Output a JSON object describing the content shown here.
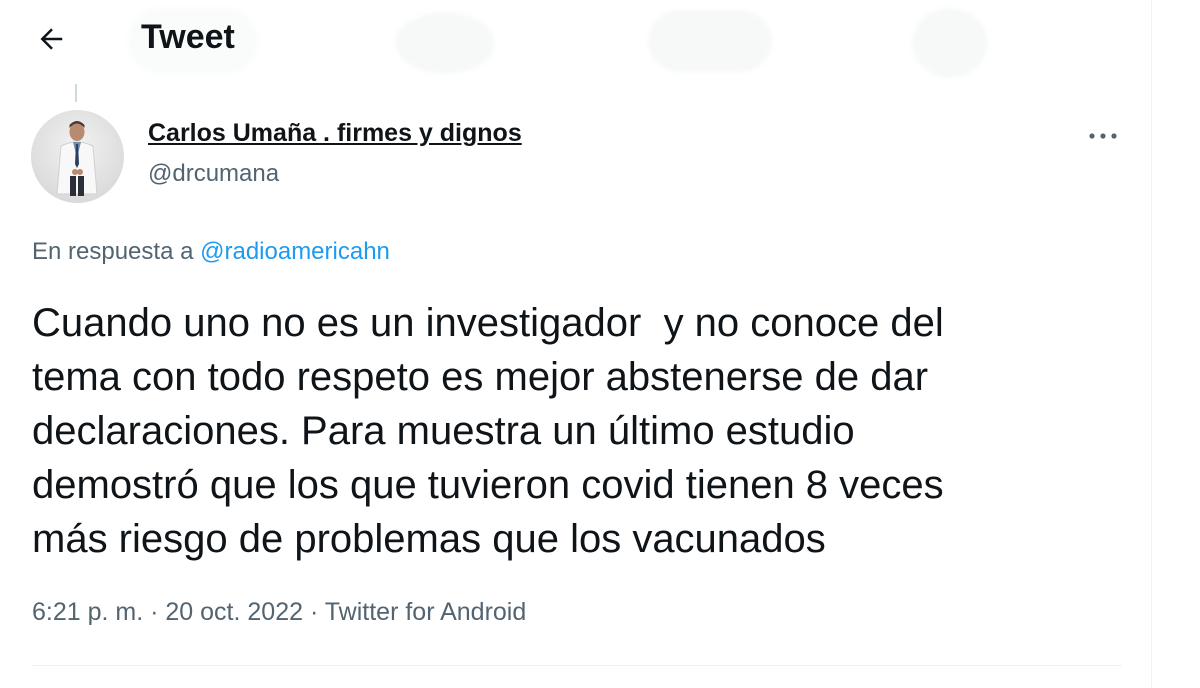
{
  "header": {
    "title": "Tweet",
    "back_icon": "arrow-left-icon"
  },
  "tweet": {
    "author": {
      "display_name": "Carlos Umaña . firmes y dignos",
      "handle": "@drcumana"
    },
    "more_icon": "ellipsis-icon",
    "reply_prefix": "En respuesta a ",
    "reply_mention": "@radioamericahn",
    "text": "Cuando uno no es un investigador  y no conoce del\ntema con todo respeto es mejor abstenerse de dar\ndeclaraciones. Para muestra un último estudio\ndemostró que los que tuvieron covid tienen 8 veces\nmás riesgo de problemas que los vacunados",
    "time": "6:21 p. m.",
    "separator1": " · ",
    "date": "20 oct. 2022",
    "separator2": " · ",
    "source": "Twitter for Android"
  },
  "colors": {
    "text_primary": "#0f1419",
    "text_secondary": "#536471",
    "link": "#1d9bf0",
    "border": "#eff3f4"
  }
}
